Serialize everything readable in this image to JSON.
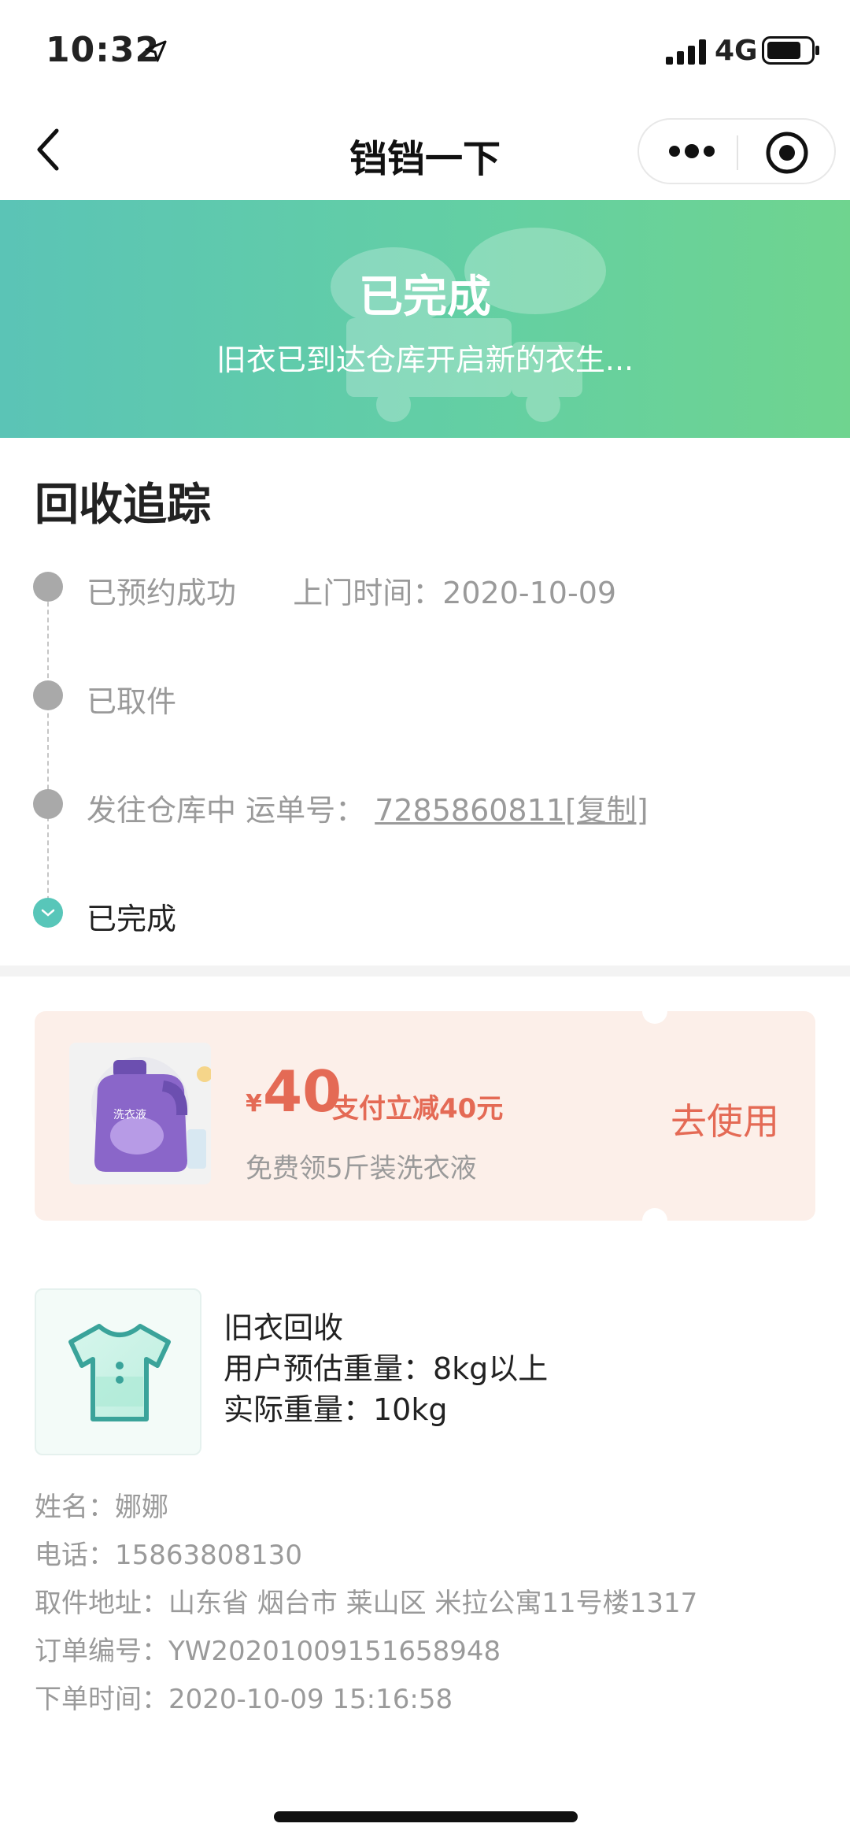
{
  "status_bar": {
    "time": "10:32",
    "network": "4G"
  },
  "nav": {
    "title": "铛铛一下"
  },
  "banner": {
    "title": "已完成",
    "subtitle": "旧衣已到达仓库开启新的衣生..."
  },
  "tracking": {
    "title": "回收追踪",
    "steps": [
      {
        "label": "已预约成功",
        "extra": "上门时间：2020-10-09"
      },
      {
        "label": "已取件"
      },
      {
        "label": "发往仓库中 运单号：",
        "tracking_no": "7285860811",
        "copy_label": "[复制]"
      },
      {
        "label": "已完成"
      }
    ]
  },
  "coupon": {
    "currency": "¥",
    "amount": "40",
    "desc": "支付立减40元",
    "sub": "免费领5斤装洗衣液",
    "button": "去使用",
    "product_label": "洗衣液"
  },
  "item": {
    "title": "旧衣回收",
    "estimate": "用户预估重量：8kg以上",
    "actual": "实际重量：10kg"
  },
  "info": {
    "name": "姓名：娜娜",
    "phone": "电话：15863808130",
    "address": "取件地址：山东省 烟台市 莱山区 米拉公寓11号楼1317",
    "order_no": "订单编号：YW20201009151658948",
    "order_time": "下单时间：2020-10-09 15:16:58"
  },
  "colors": {
    "accent": "#58c6b9",
    "coupon": "#e46a55",
    "banner_start": "#5bc4b6",
    "banner_end": "#6fd48f"
  }
}
